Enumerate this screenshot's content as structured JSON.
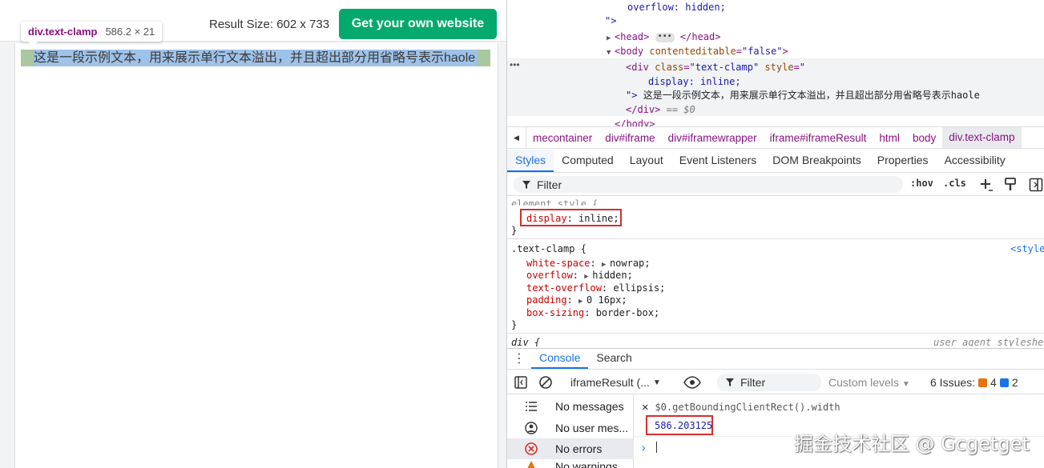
{
  "preview": {
    "result_size": "Result Size: 602 x 733",
    "own_website_button": "Get your own website",
    "tooltip_name": "div.text-clamp",
    "tooltip_size": "586.2 × 21",
    "clamp_text": "这是一段示例文本，用来展示单行文本溢出，并且超出部分用省略号表示haole"
  },
  "dom": {
    "line_overflow": "overflow: hidden;",
    "line_close_attr": "\">",
    "head_open": "<head>",
    "head_close": "</head>",
    "body_tag": "<body",
    "body_attr_name": "contenteditable",
    "body_attr_value": "\"false\"",
    "div_tag": "<div",
    "div_class_name": "class",
    "div_class_value": "\"text-clamp\"",
    "div_style_name": "style",
    "div_style_open": "\"",
    "div_style_display": "display: inline;",
    "div_text_prefix": "\">",
    "div_text": "这是一段示例文本，用来展示单行文本溢出，并且超出部分用省略号表示haole",
    "div_close": "</div>",
    "div_marker": "== $0",
    "body_close": "</body>"
  },
  "breadcrumb": [
    "mecontainer",
    "div#iframe",
    "div#iframewrapper",
    "iframe#iframeResult",
    "html",
    "body",
    "div.text-clamp"
  ],
  "tabs": [
    "Styles",
    "Computed",
    "Layout",
    "Event Listeners",
    "DOM Breakpoints",
    "Properties",
    "Accessibility"
  ],
  "styles": {
    "filter_placeholder": "Filter",
    "hov": ":hov",
    "cls": ".cls",
    "element_style_selector": "element.style {",
    "element_style_prop": "display",
    "element_style_value": "inline;",
    "close_brace": "}",
    "text_clamp_selector": ".text-clamp {",
    "text_clamp_source": "<style",
    "text_clamp_props": [
      {
        "name": "white-space",
        "value": "nowrap;",
        "expand": true
      },
      {
        "name": "overflow",
        "value": "hidden;",
        "expand": true
      },
      {
        "name": "text-overflow",
        "value": "ellipsis;",
        "expand": false
      },
      {
        "name": "padding",
        "value": "0 16px;",
        "expand": true
      },
      {
        "name": "box-sizing",
        "value": "border-box;",
        "expand": false
      }
    ],
    "div_selector": "div {",
    "div_source": "user agent stylesheet"
  },
  "drawer": {
    "tabs": [
      "Console",
      "Search"
    ],
    "context": "iframeResult (...",
    "filter_placeholder": "Filter",
    "levels": "Custom levels",
    "issues_label": "6 Issues:",
    "issues_warn": "4",
    "issues_info": "2",
    "sidebar": [
      "No messages",
      "No user mes...",
      "No errors",
      "No warnings"
    ],
    "expression": "$0.getBoundingClientRect().width",
    "result": "586.203125"
  },
  "watermark": "掘金技术社区 @ Gcgetget",
  "colors": {
    "brand_green": "#04aa6d",
    "accent_blue": "#1a73e8",
    "highlight_red": "#d32f2f"
  }
}
